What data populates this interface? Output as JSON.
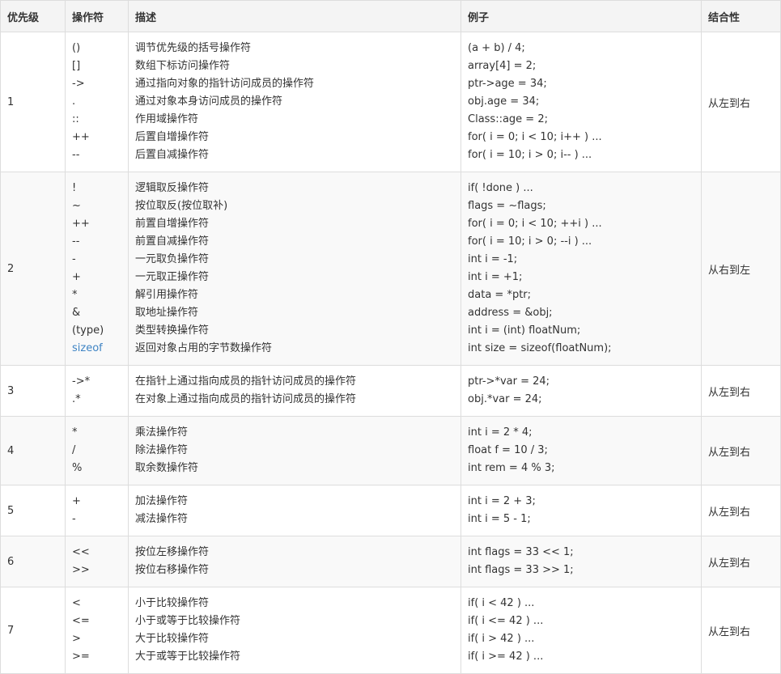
{
  "headers": [
    "优先级",
    "操作符",
    "描述",
    "例子",
    "结合性"
  ],
  "rows": [
    {
      "priority": "1",
      "assoc": "从左到右",
      "items": [
        {
          "op": "()",
          "desc": "调节优先级的括号操作符",
          "ex": "(a + b) / 4;"
        },
        {
          "op": "[]",
          "desc": "数组下标访问操作符",
          "ex": "array[4] = 2;"
        },
        {
          "op": "->",
          "desc": "通过指向对象的指针访问成员的操作符",
          "ex": "ptr->age = 34;"
        },
        {
          "op": ".",
          "desc": "通过对象本身访问成员的操作符",
          "ex": "obj.age = 34;"
        },
        {
          "op": "::",
          "desc": "作用域操作符",
          "ex": "Class::age = 2;"
        },
        {
          "op": "++",
          "desc": "后置自增操作符",
          "ex": "for( i = 0; i < 10; i++ ) ..."
        },
        {
          "op": "--",
          "desc": "后置自减操作符",
          "ex": "for( i = 10; i > 0; i-- ) ..."
        }
      ]
    },
    {
      "priority": "2",
      "assoc": "从右到左",
      "items": [
        {
          "op": "!",
          "desc": "逻辑取反操作符",
          "ex": "if( !done ) ..."
        },
        {
          "op": "~",
          "desc": "按位取反(按位取补)",
          "ex": "flags = ~flags;"
        },
        {
          "op": "++",
          "desc": "前置自增操作符",
          "ex": "for( i = 0; i < 10; ++i ) ..."
        },
        {
          "op": "--",
          "desc": "前置自减操作符",
          "ex": "for( i = 10; i > 0; --i ) ..."
        },
        {
          "op": "-",
          "desc": "一元取负操作符",
          "ex": "int i = -1;"
        },
        {
          "op": "+",
          "desc": "一元取正操作符",
          "ex": "int i = +1;"
        },
        {
          "op": "*",
          "desc": "解引用操作符",
          "ex": "data = *ptr;"
        },
        {
          "op": "&",
          "desc": "取地址操作符",
          "ex": "address = &obj;"
        },
        {
          "op": "(type)",
          "desc": "类型转换操作符",
          "ex": "int i = (int) floatNum;"
        },
        {
          "op": "sizeof",
          "desc": "返回对象占用的字节数操作符",
          "ex": "int size = sizeof(floatNum);",
          "link": true
        }
      ]
    },
    {
      "priority": "3",
      "assoc": "从左到右",
      "items": [
        {
          "op": "->*",
          "desc": "在指针上通过指向成员的指针访问成员的操作符",
          "ex": "ptr->*var = 24;"
        },
        {
          "op": ".*",
          "desc": "在对象上通过指向成员的指针访问成员的操作符",
          "ex": "obj.*var = 24;"
        }
      ]
    },
    {
      "priority": "4",
      "assoc": "从左到右",
      "items": [
        {
          "op": "*",
          "desc": "乘法操作符",
          "ex": "int i = 2 * 4;"
        },
        {
          "op": "/",
          "desc": "除法操作符",
          "ex": "float f = 10 / 3;"
        },
        {
          "op": "%",
          "desc": "取余数操作符",
          "ex": "int rem = 4 % 3;"
        }
      ]
    },
    {
      "priority": "5",
      "assoc": "从左到右",
      "items": [
        {
          "op": "+",
          "desc": "加法操作符",
          "ex": "int i = 2 + 3;"
        },
        {
          "op": "-",
          "desc": "减法操作符",
          "ex": "int i = 5 - 1;"
        }
      ]
    },
    {
      "priority": "6",
      "assoc": "从左到右",
      "items": [
        {
          "op": "<<",
          "desc": "按位左移操作符",
          "ex": "int flags = 33 << 1;"
        },
        {
          "op": ">>",
          "desc": "按位右移操作符",
          "ex": "int flags = 33 >> 1;"
        }
      ]
    },
    {
      "priority": "7",
      "assoc": "从左到右",
      "items": [
        {
          "op": "<",
          "desc": "小于比较操作符",
          "ex": "if( i < 42 ) ..."
        },
        {
          "op": "<=",
          "desc": "小于或等于比较操作符",
          "ex": "if( i <= 42 ) ..."
        },
        {
          "op": ">",
          "desc": "大于比较操作符",
          "ex": "if( i > 42 ) ..."
        },
        {
          "op": ">=",
          "desc": "大于或等于比较操作符",
          "ex": "if( i >= 42 ) ..."
        }
      ]
    }
  ]
}
